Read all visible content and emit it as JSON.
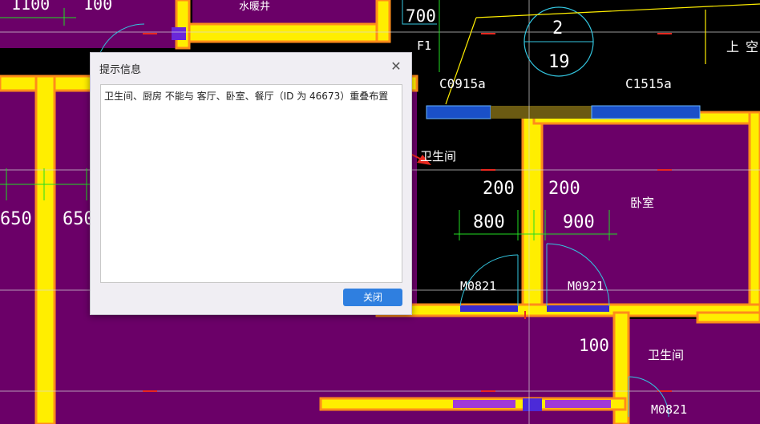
{
  "cad": {
    "labels": {
      "dim_1100": "1100",
      "dim_100_top": "100",
      "label_shuinuanjing": "水暖井",
      "dim_700": "700",
      "label_f1": "F1",
      "circle_number": "2",
      "circle_sub": "19",
      "label_shang": "上",
      "label_kong": "空",
      "window_c0915": "C0915a",
      "window_c1515": "C1515a",
      "room_weishengjian": "卫生间",
      "room_woshi": "卧室",
      "room_weishengjian_2": "卫生间",
      "dim_200_left": "200",
      "dim_200_right": "200",
      "dim_800": "800",
      "dim_900": "900",
      "dim_650_a": "650",
      "dim_650_b": "650",
      "door_m0821_a": "M0821",
      "door_m0921": "M0921",
      "door_m0821_b": "M0821",
      "dim_100_bottom": "100"
    },
    "colors": {
      "background": "#000000",
      "room_fill": "#6b0068",
      "wall_yellow": "#ffee00",
      "wall_orange": "#ff8c1a",
      "annotation_arrow": "#e8281f",
      "dim_green": "#22dd22",
      "door_cyan": "#33c6e0"
    }
  },
  "dialog": {
    "title": "提示信息",
    "message": "卫生间、厨房 不能与 客厅、卧室、餐厅（ID 为 46673）重叠布置",
    "close_button": "关闭",
    "close_icon": "close-icon"
  }
}
